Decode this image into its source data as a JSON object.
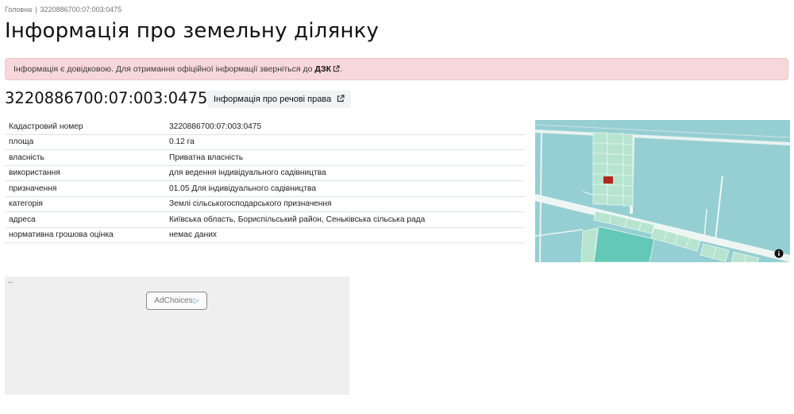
{
  "breadcrumb": {
    "home": "Головна",
    "separator": "|",
    "current": "3220886700:07:003:0475"
  },
  "page_title": "Інформація про земельну ділянку",
  "alert": {
    "text": "Інформація є довідковою. Для отримання офіційної інформації зверніться до ",
    "link": "ДЗК",
    "end": "."
  },
  "cadastral_title": "3220886700:07:003:0475",
  "rights_button": "Інформація про речові права",
  "table": [
    {
      "label": "Кадастровий номер",
      "value": "3220886700:07:003:0475"
    },
    {
      "label": "площа",
      "value": "0.12 га"
    },
    {
      "label": "власність",
      "value": "Приватна власність"
    },
    {
      "label": "використання",
      "value": "для ведення індивідуального садівництва"
    },
    {
      "label": "призначення",
      "value": "01.05 Для індивідуального садівництва"
    },
    {
      "label": "категорія",
      "value": "Землі сільськогосподарського призначення"
    },
    {
      "label": "адреса",
      "value": "Київська область, Бориспільський район, Сеньківська сільська рада"
    },
    {
      "label": "нормативна грошова оцінка",
      "value": "немає даних"
    }
  ],
  "ad": {
    "back_arrow": "←",
    "adchoices_label": "AdChoices",
    "adchoices_icon": "▷"
  },
  "colors": {
    "alert_bg": "#f8d7da",
    "map_water": "#95cfd3",
    "parcel_green": "#b6e4cf",
    "highlight_parcel": "#b3261e"
  }
}
